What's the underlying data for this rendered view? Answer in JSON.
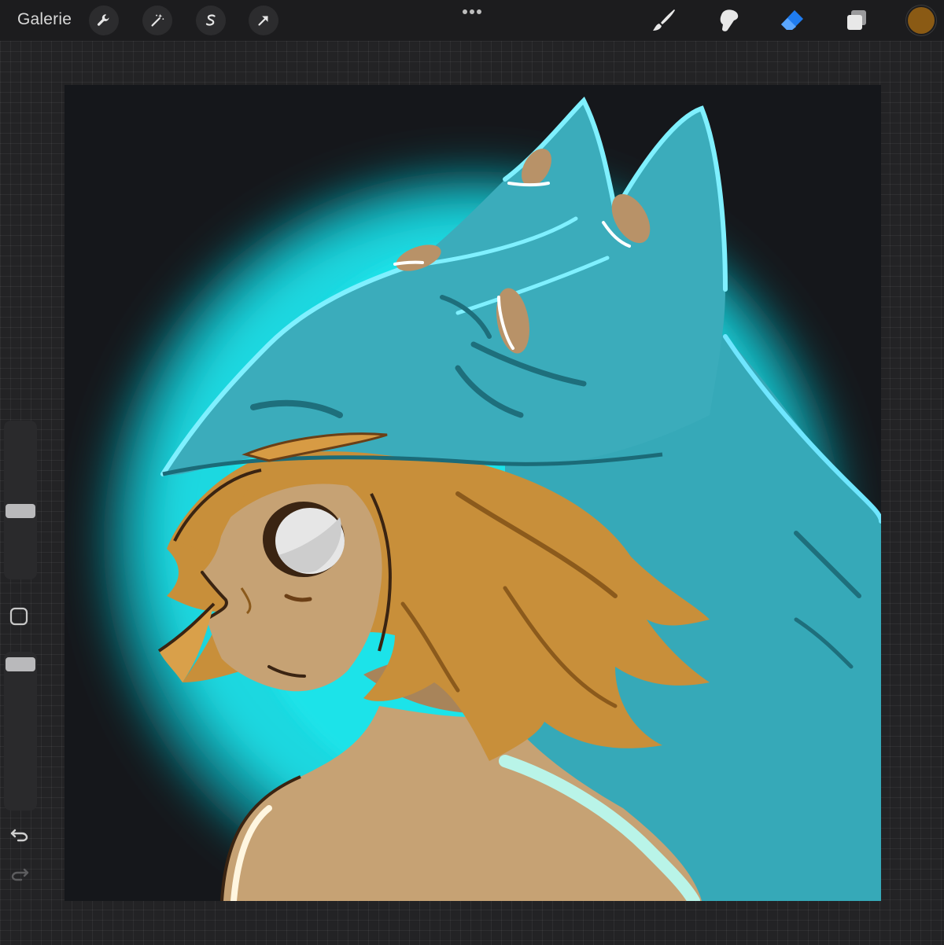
{
  "topbar": {
    "gallery_label": "Galerie",
    "actions": [
      {
        "name": "actions-wrench",
        "icon": "wrench-icon"
      },
      {
        "name": "adjustments-wand",
        "icon": "magic-wand-icon"
      },
      {
        "name": "selection",
        "icon": "selection-s-icon"
      },
      {
        "name": "transform",
        "icon": "arrow-cursor-icon"
      }
    ],
    "tools": [
      {
        "name": "brush",
        "icon": "brush-icon",
        "active": false
      },
      {
        "name": "smudge",
        "icon": "smudge-icon",
        "active": false
      },
      {
        "name": "eraser",
        "icon": "eraser-icon",
        "active": true
      },
      {
        "name": "layers",
        "icon": "layers-icon",
        "active": false
      }
    ],
    "current_color": "#8a5a14",
    "accent_color": "#1f7cf0"
  },
  "sidebar": {
    "brush_size_level": 0.42,
    "opacity_level": 0.97,
    "icons": [
      "modify-square-icon",
      "undo-icon",
      "redo-icon"
    ]
  },
  "canvas": {
    "background": "#15171b",
    "glow_color": "#1ad8e0",
    "hood_color": "#36a9b8",
    "hair_color": "#c88f3a",
    "skin_color": "#c6a274"
  }
}
